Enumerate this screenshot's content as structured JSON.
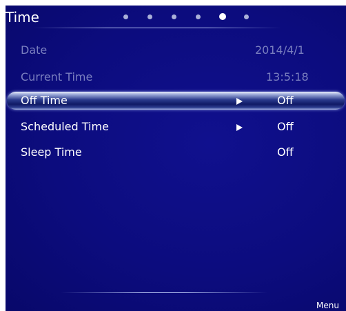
{
  "header": {
    "title": "Time",
    "page_indicator": {
      "total": 6,
      "current": 5
    }
  },
  "settings": [
    {
      "label": "Date",
      "value": "2014/4/1",
      "state": "disabled",
      "has_arrow": false
    },
    {
      "label": "Current Time",
      "value": "13:5:18",
      "state": "disabled",
      "has_arrow": false
    },
    {
      "label": "Off Time",
      "value": "Off",
      "state": "selected",
      "has_arrow": true
    },
    {
      "label": "Scheduled Time",
      "value": "Off",
      "state": "enabled",
      "has_arrow": true
    },
    {
      "label": "Sleep Time",
      "value": "Off",
      "state": "enabled",
      "has_arrow": false
    }
  ],
  "footer": {
    "menu_label": "Menu"
  },
  "colors": {
    "background": "#0c0c7e",
    "text": "#ffffff",
    "disabled_text": "#7a7fbf",
    "highlight": "#9aa8d8"
  }
}
